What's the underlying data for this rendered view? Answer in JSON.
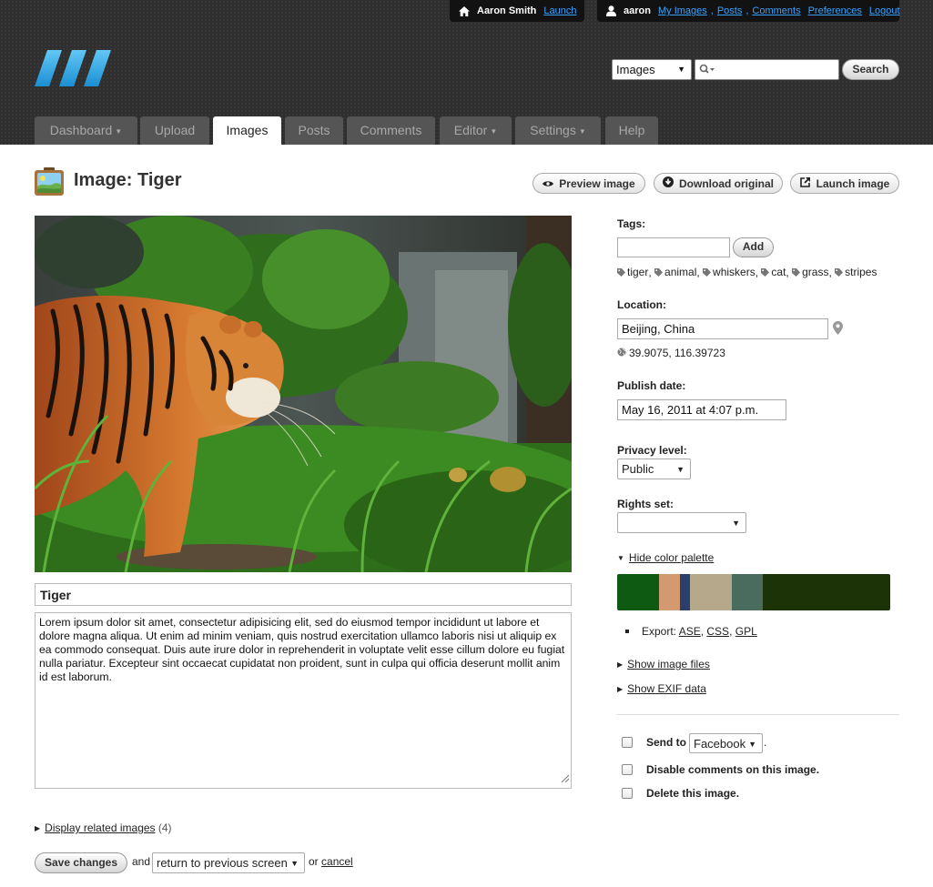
{
  "topbar": {
    "site_user_name": "Aaron Smith",
    "site_launch_link": "Launch",
    "account_username": "aaron",
    "account_links": [
      "My Images",
      "Posts",
      "Comments"
    ],
    "preferences_link": "Preferences",
    "logout_link": "Logout"
  },
  "search": {
    "scope_value": "Images",
    "placeholder": "",
    "button_label": "Search"
  },
  "tabs": [
    {
      "label": "Dashboard",
      "dropdown": true
    },
    {
      "label": "Upload",
      "dropdown": false
    },
    {
      "label": "Images",
      "dropdown": false,
      "active": true
    },
    {
      "label": "Posts",
      "dropdown": false
    },
    {
      "label": "Comments",
      "dropdown": false
    },
    {
      "label": "Editor",
      "dropdown": true
    },
    {
      "label": "Settings",
      "dropdown": true
    },
    {
      "label": "Help",
      "dropdown": false
    }
  ],
  "page": {
    "title": "Image: Tiger",
    "actions": {
      "preview": "Preview image",
      "download": "Download original",
      "launch": "Launch image"
    }
  },
  "image": {
    "title_value": "Tiger",
    "description": "Lorem ipsum dolor sit amet, consectetur adipisicing elit, sed do eiusmod tempor incididunt ut labore et dolore magna aliqua. Ut enim ad minim veniam, quis nostrud exercitation ullamco laboris nisi ut aliquip ex ea commodo consequat. Duis aute irure dolor in reprehenderit in voluptate velit esse cillum dolore eu fugiat nulla pariatur. Excepteur sint occaecat cupidatat non proident, sunt in culpa qui officia deserunt mollit anim id est laborum."
  },
  "related": {
    "link": "Display related images",
    "count": "(4)"
  },
  "footer": {
    "save_label": "Save changes",
    "and_text": "and",
    "return_value": "return to previous screen",
    "or_text": "or",
    "cancel_link": "cancel"
  },
  "sidebar": {
    "tags_label": "Tags:",
    "tags_input_value": "",
    "add_label": "Add",
    "tags": [
      "tiger",
      "animal",
      "whiskers",
      "cat",
      "grass",
      "stripes"
    ],
    "location_label": "Location:",
    "location_value": "Beijing, China",
    "coordinates": "39.9075, 116.39723",
    "publish_label": "Publish date:",
    "publish_value": "May 16, 2011 at 4:07 p.m.",
    "privacy_label": "Privacy level:",
    "privacy_value": "Public",
    "rights_label": "Rights set:",
    "rights_value": "",
    "palette_toggle": "Hide color palette",
    "palette_colors": [
      "#0e5a12",
      "#d39a71",
      "#2a3f6e",
      "#b6a88a",
      "#4a6c5e",
      "#1b3307"
    ],
    "export_label": "Export:",
    "export_links": [
      "ASE",
      "CSS",
      "GPL"
    ],
    "show_files": "Show image files",
    "show_exif": "Show EXIF data",
    "send_to_label": "Send to",
    "send_to_value": "Facebook",
    "send_to_period": ".",
    "disable_comments_label": "Disable comments on this image.",
    "delete_label": "Delete this image."
  },
  "colors": {
    "link_blue": "#3aa3ff",
    "header_bg": "#2f2f2f",
    "logo_blue": "#29a8e6"
  }
}
